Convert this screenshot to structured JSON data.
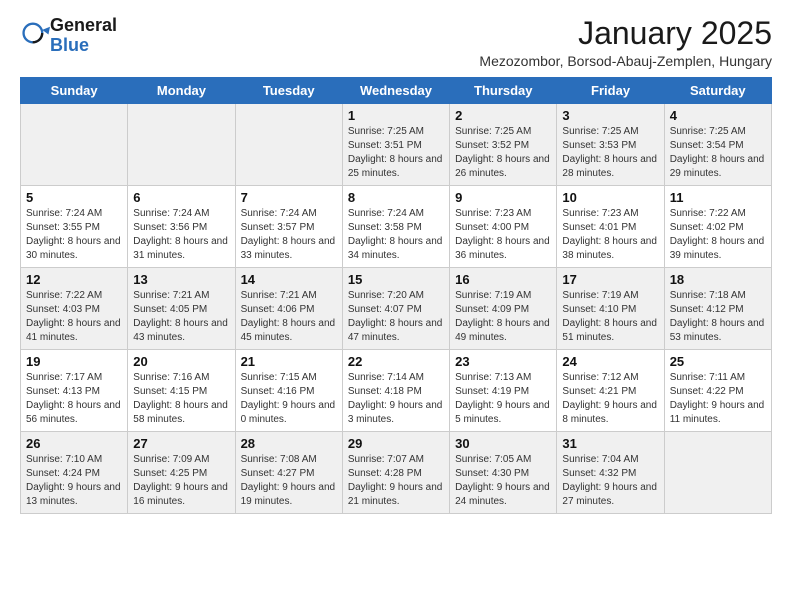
{
  "logo": {
    "general": "General",
    "blue": "Blue"
  },
  "header": {
    "title": "January 2025",
    "subtitle": "Mezozombor, Borsod-Abauj-Zemplen, Hungary"
  },
  "days_of_week": [
    "Sunday",
    "Monday",
    "Tuesday",
    "Wednesday",
    "Thursday",
    "Friday",
    "Saturday"
  ],
  "weeks": [
    [
      {
        "day": "",
        "info": ""
      },
      {
        "day": "",
        "info": ""
      },
      {
        "day": "",
        "info": ""
      },
      {
        "day": "1",
        "info": "Sunrise: 7:25 AM\nSunset: 3:51 PM\nDaylight: 8 hours and 25 minutes."
      },
      {
        "day": "2",
        "info": "Sunrise: 7:25 AM\nSunset: 3:52 PM\nDaylight: 8 hours and 26 minutes."
      },
      {
        "day": "3",
        "info": "Sunrise: 7:25 AM\nSunset: 3:53 PM\nDaylight: 8 hours and 28 minutes."
      },
      {
        "day": "4",
        "info": "Sunrise: 7:25 AM\nSunset: 3:54 PM\nDaylight: 8 hours and 29 minutes."
      }
    ],
    [
      {
        "day": "5",
        "info": "Sunrise: 7:24 AM\nSunset: 3:55 PM\nDaylight: 8 hours and 30 minutes."
      },
      {
        "day": "6",
        "info": "Sunrise: 7:24 AM\nSunset: 3:56 PM\nDaylight: 8 hours and 31 minutes."
      },
      {
        "day": "7",
        "info": "Sunrise: 7:24 AM\nSunset: 3:57 PM\nDaylight: 8 hours and 33 minutes."
      },
      {
        "day": "8",
        "info": "Sunrise: 7:24 AM\nSunset: 3:58 PM\nDaylight: 8 hours and 34 minutes."
      },
      {
        "day": "9",
        "info": "Sunrise: 7:23 AM\nSunset: 4:00 PM\nDaylight: 8 hours and 36 minutes."
      },
      {
        "day": "10",
        "info": "Sunrise: 7:23 AM\nSunset: 4:01 PM\nDaylight: 8 hours and 38 minutes."
      },
      {
        "day": "11",
        "info": "Sunrise: 7:22 AM\nSunset: 4:02 PM\nDaylight: 8 hours and 39 minutes."
      }
    ],
    [
      {
        "day": "12",
        "info": "Sunrise: 7:22 AM\nSunset: 4:03 PM\nDaylight: 8 hours and 41 minutes."
      },
      {
        "day": "13",
        "info": "Sunrise: 7:21 AM\nSunset: 4:05 PM\nDaylight: 8 hours and 43 minutes."
      },
      {
        "day": "14",
        "info": "Sunrise: 7:21 AM\nSunset: 4:06 PM\nDaylight: 8 hours and 45 minutes."
      },
      {
        "day": "15",
        "info": "Sunrise: 7:20 AM\nSunset: 4:07 PM\nDaylight: 8 hours and 47 minutes."
      },
      {
        "day": "16",
        "info": "Sunrise: 7:19 AM\nSunset: 4:09 PM\nDaylight: 8 hours and 49 minutes."
      },
      {
        "day": "17",
        "info": "Sunrise: 7:19 AM\nSunset: 4:10 PM\nDaylight: 8 hours and 51 minutes."
      },
      {
        "day": "18",
        "info": "Sunrise: 7:18 AM\nSunset: 4:12 PM\nDaylight: 8 hours and 53 minutes."
      }
    ],
    [
      {
        "day": "19",
        "info": "Sunrise: 7:17 AM\nSunset: 4:13 PM\nDaylight: 8 hours and 56 minutes."
      },
      {
        "day": "20",
        "info": "Sunrise: 7:16 AM\nSunset: 4:15 PM\nDaylight: 8 hours and 58 minutes."
      },
      {
        "day": "21",
        "info": "Sunrise: 7:15 AM\nSunset: 4:16 PM\nDaylight: 9 hours and 0 minutes."
      },
      {
        "day": "22",
        "info": "Sunrise: 7:14 AM\nSunset: 4:18 PM\nDaylight: 9 hours and 3 minutes."
      },
      {
        "day": "23",
        "info": "Sunrise: 7:13 AM\nSunset: 4:19 PM\nDaylight: 9 hours and 5 minutes."
      },
      {
        "day": "24",
        "info": "Sunrise: 7:12 AM\nSunset: 4:21 PM\nDaylight: 9 hours and 8 minutes."
      },
      {
        "day": "25",
        "info": "Sunrise: 7:11 AM\nSunset: 4:22 PM\nDaylight: 9 hours and 11 minutes."
      }
    ],
    [
      {
        "day": "26",
        "info": "Sunrise: 7:10 AM\nSunset: 4:24 PM\nDaylight: 9 hours and 13 minutes."
      },
      {
        "day": "27",
        "info": "Sunrise: 7:09 AM\nSunset: 4:25 PM\nDaylight: 9 hours and 16 minutes."
      },
      {
        "day": "28",
        "info": "Sunrise: 7:08 AM\nSunset: 4:27 PM\nDaylight: 9 hours and 19 minutes."
      },
      {
        "day": "29",
        "info": "Sunrise: 7:07 AM\nSunset: 4:28 PM\nDaylight: 9 hours and 21 minutes."
      },
      {
        "day": "30",
        "info": "Sunrise: 7:05 AM\nSunset: 4:30 PM\nDaylight: 9 hours and 24 minutes."
      },
      {
        "day": "31",
        "info": "Sunrise: 7:04 AM\nSunset: 4:32 PM\nDaylight: 9 hours and 27 minutes."
      },
      {
        "day": "",
        "info": ""
      }
    ]
  ]
}
